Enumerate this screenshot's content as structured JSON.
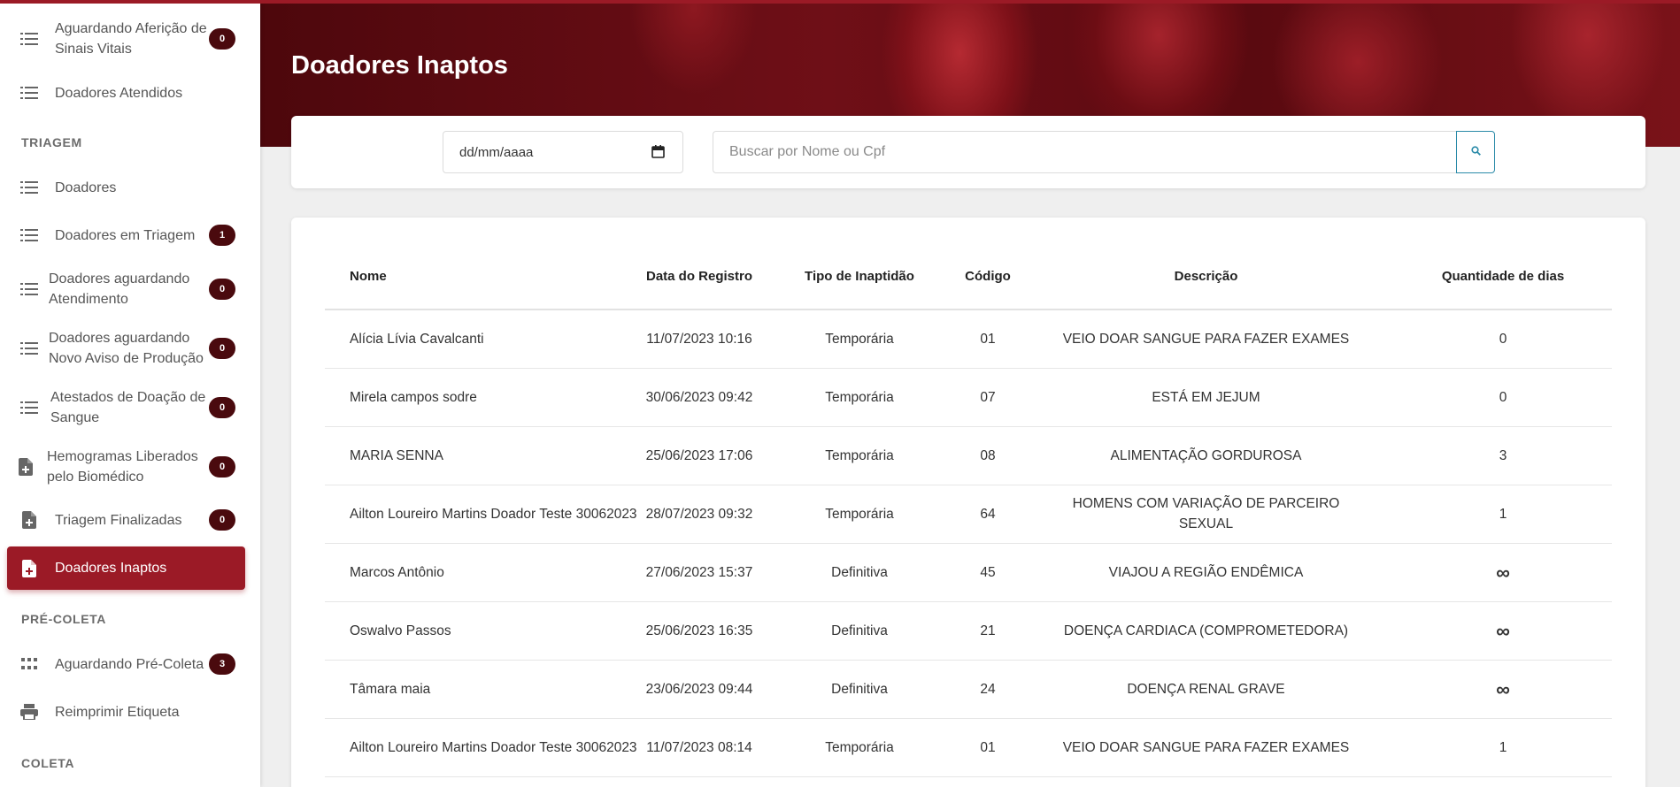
{
  "sidebar": {
    "items": [
      {
        "label": "Aguardando Aferição de Sinais Vitais",
        "badge": "0",
        "icon": "list-icon"
      },
      {
        "label": "Doadores Atendidos",
        "badge": "",
        "icon": "list-icon"
      },
      {
        "label": "Doadores",
        "badge": "",
        "icon": "list-icon"
      },
      {
        "label": "Doadores em Triagem",
        "badge": "1",
        "icon": "list-icon"
      },
      {
        "label": "Doadores aguardando Atendimento",
        "badge": "0",
        "icon": "list-icon"
      },
      {
        "label": "Doadores aguardando Novo Aviso de Produção",
        "badge": "0",
        "icon": "list-icon"
      },
      {
        "label": "Atestados de Doação de Sangue",
        "badge": "0",
        "icon": "list-icon"
      },
      {
        "label": "Hemogramas Liberados pelo Biomédico",
        "badge": "0",
        "icon": "file-plus-icon"
      },
      {
        "label": "Triagem Finalizadas",
        "badge": "0",
        "icon": "file-plus-icon"
      },
      {
        "label": "Doadores Inaptos",
        "badge": "",
        "icon": "file-plus-icon"
      },
      {
        "label": "Aguardando Pré-Coleta",
        "badge": "3",
        "icon": "grid-icon"
      },
      {
        "label": "Reimprimir Etiqueta",
        "badge": "",
        "icon": "printer-icon"
      }
    ],
    "sections": {
      "triagem": "TRIAGEM",
      "pre_coleta": "PRÉ-COLETA",
      "coleta": "COLETA"
    }
  },
  "header": {
    "title": "Doadores Inaptos"
  },
  "filters": {
    "date_placeholder": "dd/mm/aaaa",
    "search_placeholder": "Buscar por Nome ou Cpf"
  },
  "table": {
    "headers": {
      "nome": "Nome",
      "data": "Data do Registro",
      "tipo": "Tipo de Inaptidão",
      "codigo": "Código",
      "descricao": "Descrição",
      "dias": "Quantidade de dias"
    },
    "rows": [
      {
        "nome": "Alícia Lívia Cavalcanti",
        "data": "11/07/2023 10:16",
        "tipo": "Temporária",
        "codigo": "01",
        "descricao": "VEIO DOAR SANGUE PARA FAZER EXAMES",
        "dias": "0"
      },
      {
        "nome": "Mirela campos sodre",
        "data": "30/06/2023 09:42",
        "tipo": "Temporária",
        "codigo": "07",
        "descricao": "ESTÁ EM JEJUM",
        "dias": "0"
      },
      {
        "nome": "MARIA SENNA",
        "data": "25/06/2023 17:06",
        "tipo": "Temporária",
        "codigo": "08",
        "descricao": "ALIMENTAÇÃO GORDUROSA",
        "dias": "3"
      },
      {
        "nome": "Ailton Loureiro Martins Doador Teste 30062023",
        "data": "28/07/2023 09:32",
        "tipo": "Temporária",
        "codigo": "64",
        "descricao": "HOMENS COM VARIAÇÃO DE PARCEIRO SEXUAL",
        "dias": "1"
      },
      {
        "nome": "Marcos Antônio",
        "data": "27/06/2023 15:37",
        "tipo": "Definitiva",
        "codigo": "45",
        "descricao": "VIAJOU A REGIÃO ENDÊMICA",
        "dias": "∞"
      },
      {
        "nome": "Oswalvo Passos",
        "data": "25/06/2023 16:35",
        "tipo": "Definitiva",
        "codigo": "21",
        "descricao": "DOENÇA CARDIACA (COMPROMETEDORA)",
        "dias": "∞"
      },
      {
        "nome": "Tâmara maia",
        "data": "23/06/2023 09:44",
        "tipo": "Definitiva",
        "codigo": "24",
        "descricao": "DOENÇA RENAL GRAVE",
        "dias": "∞"
      },
      {
        "nome": "Ailton Loureiro Martins Doador Teste 30062023",
        "data": "11/07/2023 08:14",
        "tipo": "Temporária",
        "codigo": "01",
        "descricao": "VEIO DOAR SANGUE PARA FAZER EXAMES",
        "dias": "1"
      }
    ]
  },
  "colors": {
    "accent": "#9b1a26",
    "badge": "#4a0a0e",
    "search_border": "#2a8aa8"
  }
}
